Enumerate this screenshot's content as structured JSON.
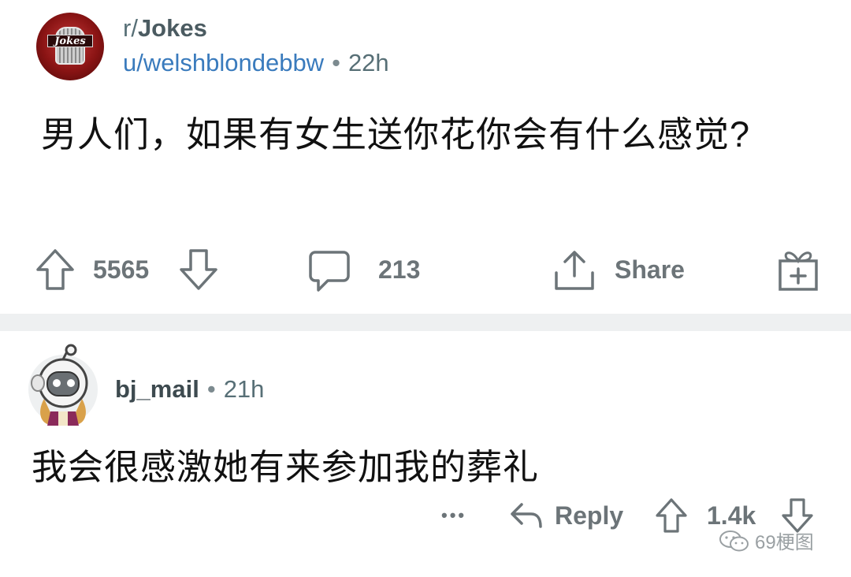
{
  "post": {
    "subreddit": "r/Jokes",
    "subreddit_prefix": "r/",
    "subreddit_name": "Jokes",
    "avatar_label": "Jokes",
    "username": "u/welshblondebbw",
    "separator": "•",
    "age": "22h",
    "title": "男人们，如果有女生送你花你会有什么感觉?",
    "upvotes": "5565",
    "comments": "213",
    "share_label": "Share"
  },
  "comment": {
    "username": "bj_mail",
    "separator": "•",
    "age": "21h",
    "body": "我会很感激她有来参加我的葬礼",
    "more": "•••",
    "reply_label": "Reply",
    "votes": "1.4k"
  },
  "watermark": {
    "text": "69梗图"
  },
  "colors": {
    "username": "#3a7bbd",
    "icon_gray": "#6c7478",
    "divider": "#eef0f1"
  }
}
